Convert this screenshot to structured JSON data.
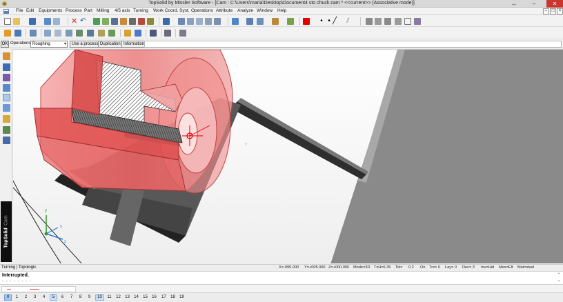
{
  "window": {
    "title": "TopSolid by Missler Software - [Cam : C:\\Users\\maria\\Desktop\\Document4 sto chuck.cam * <<current>> (Associative mode)]",
    "restore_glyph": "↔",
    "minimize_glyph": "–",
    "close_glyph": "✕"
  },
  "menu": {
    "items": [
      "File",
      "Edit",
      "Equipments",
      "Process",
      "Part",
      "Milling",
      "4/5 axis",
      "Turning",
      "Work Coord. Syst.",
      "Operations",
      "Attribute",
      "Analyze",
      "Window",
      "Help"
    ],
    "mdi_minimize": "–",
    "mdi_restore": "□",
    "mdi_close": "×"
  },
  "operation_bar": {
    "ok_label": "OK",
    "operations_label": "Operations",
    "operation_value": "Roughing",
    "use_process_label": "Use a process",
    "duplication_label": "Duplication",
    "information_label": "Information"
  },
  "brand": {
    "name": "TopSolid",
    "module": "' Cam"
  },
  "status": {
    "mode": "Turning | Topologic.",
    "x": "X=-095.000",
    "y": "Y=+005.000",
    "z": "Z=+000.000",
    "view_mode": "Mode=3D",
    "txh": "TxH=6.35",
    "tol": "Tol=",
    "tol_value": "0.2",
    "on": "On",
    "trs": "Trs= 0",
    "lay": "Lay= 0",
    "dec": "Dec= 3",
    "inv": "Inv=Hid",
    "mes": "Mes=Elt",
    "mat": "Mat=steel"
  },
  "message": {
    "text": "Interrupted.",
    "dashes": "- - - - - - - -"
  },
  "axes": {
    "x_label": "x",
    "y_label": "y",
    "z_label": "z"
  },
  "tabs": [
    "0",
    "1",
    "2",
    "3",
    "4",
    "5",
    "6",
    "7",
    "8",
    "9",
    "10",
    "11",
    "12",
    "13",
    "14",
    "15",
    "16",
    "17",
    "18",
    "19"
  ],
  "active_tab": "0",
  "highlighted_tabs": [
    "5",
    "10"
  ],
  "colors": {
    "accent": "#c7372f",
    "part_red": "#e34b4b",
    "chuck_gray": "#8a8a8a",
    "tab_active": "#a6c8f0"
  }
}
